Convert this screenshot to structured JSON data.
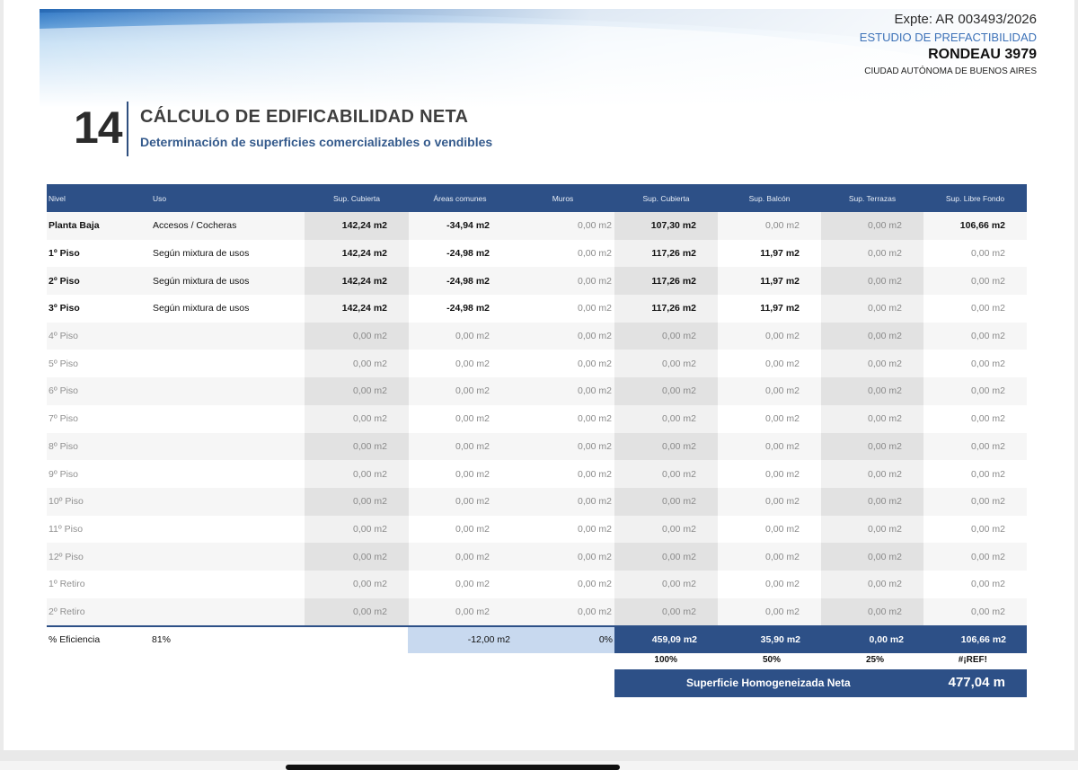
{
  "header": {
    "expediente": "Expte: AR 003493/2026",
    "estudio": "ESTUDIO DE PREFACTIBILIDAD",
    "address": "RONDEAU 3979",
    "city": "CIUDAD AUTÓNOMA DE BUENOS AIRES"
  },
  "section": {
    "number": "14",
    "title": "CÁLCULO DE EDIFICABILIDAD NETA",
    "subtitle": "Determinación de superficies comercializables o vendibles"
  },
  "table": {
    "columns": [
      "Nivel",
      "Uso",
      "Sup. Cubierta",
      "Áreas comunes",
      "Muros",
      "Sup. Cubierta",
      "Sup. Balcón",
      "Sup. Terrazas",
      "Sup. Libre Fondo"
    ],
    "rows": [
      {
        "nivel": "Planta Baja",
        "uso": "Accesos / Cocheras",
        "sup_cubierta": "142,24 m2",
        "areas_comunes": "-34,94 m2",
        "muros": "0,00 m2",
        "sup_cubierta_neta": "107,30 m2",
        "balcon": "0,00 m2",
        "terrazas": "0,00 m2",
        "libre_fondo": "106,66 m2"
      },
      {
        "nivel": "1º Piso",
        "uso": "Según mixtura de usos",
        "sup_cubierta": "142,24 m2",
        "areas_comunes": "-24,98 m2",
        "muros": "0,00 m2",
        "sup_cubierta_neta": "117,26 m2",
        "balcon": "11,97 m2",
        "terrazas": "0,00 m2",
        "libre_fondo": "0,00 m2"
      },
      {
        "nivel": "2º Piso",
        "uso": "Según mixtura de usos",
        "sup_cubierta": "142,24 m2",
        "areas_comunes": "-24,98 m2",
        "muros": "0,00 m2",
        "sup_cubierta_neta": "117,26 m2",
        "balcon": "11,97 m2",
        "terrazas": "0,00 m2",
        "libre_fondo": "0,00 m2"
      },
      {
        "nivel": "3º Piso",
        "uso": "Según mixtura de usos",
        "sup_cubierta": "142,24 m2",
        "areas_comunes": "-24,98 m2",
        "muros": "0,00 m2",
        "sup_cubierta_neta": "117,26 m2",
        "balcon": "11,97 m2",
        "terrazas": "0,00 m2",
        "libre_fondo": "0,00 m2"
      },
      {
        "nivel": "4º Piso",
        "uso": "",
        "sup_cubierta": "0,00 m2",
        "areas_comunes": "0,00 m2",
        "muros": "0,00 m2",
        "sup_cubierta_neta": "0,00 m2",
        "balcon": "0,00 m2",
        "terrazas": "0,00 m2",
        "libre_fondo": "0,00 m2"
      },
      {
        "nivel": "5º Piso",
        "uso": "",
        "sup_cubierta": "0,00 m2",
        "areas_comunes": "0,00 m2",
        "muros": "0,00 m2",
        "sup_cubierta_neta": "0,00 m2",
        "balcon": "0,00 m2",
        "terrazas": "0,00 m2",
        "libre_fondo": "0,00 m2"
      },
      {
        "nivel": "6º Piso",
        "uso": "",
        "sup_cubierta": "0,00 m2",
        "areas_comunes": "0,00 m2",
        "muros": "0,00 m2",
        "sup_cubierta_neta": "0,00 m2",
        "balcon": "0,00 m2",
        "terrazas": "0,00 m2",
        "libre_fondo": "0,00 m2"
      },
      {
        "nivel": "7º Piso",
        "uso": "",
        "sup_cubierta": "0,00 m2",
        "areas_comunes": "0,00 m2",
        "muros": "0,00 m2",
        "sup_cubierta_neta": "0,00 m2",
        "balcon": "0,00 m2",
        "terrazas": "0,00 m2",
        "libre_fondo": "0,00 m2"
      },
      {
        "nivel": "8º Piso",
        "uso": "",
        "sup_cubierta": "0,00 m2",
        "areas_comunes": "0,00 m2",
        "muros": "0,00 m2",
        "sup_cubierta_neta": "0,00 m2",
        "balcon": "0,00 m2",
        "terrazas": "0,00 m2",
        "libre_fondo": "0,00 m2"
      },
      {
        "nivel": "9º Piso",
        "uso": "",
        "sup_cubierta": "0,00 m2",
        "areas_comunes": "0,00 m2",
        "muros": "0,00 m2",
        "sup_cubierta_neta": "0,00 m2",
        "balcon": "0,00 m2",
        "terrazas": "0,00 m2",
        "libre_fondo": "0,00 m2"
      },
      {
        "nivel": "10º Piso",
        "uso": "",
        "sup_cubierta": "0,00 m2",
        "areas_comunes": "0,00 m2",
        "muros": "0,00 m2",
        "sup_cubierta_neta": "0,00 m2",
        "balcon": "0,00 m2",
        "terrazas": "0,00 m2",
        "libre_fondo": "0,00 m2"
      },
      {
        "nivel": "11º Piso",
        "uso": "",
        "sup_cubierta": "0,00 m2",
        "areas_comunes": "0,00 m2",
        "muros": "0,00 m2",
        "sup_cubierta_neta": "0,00 m2",
        "balcon": "0,00 m2",
        "terrazas": "0,00 m2",
        "libre_fondo": "0,00 m2"
      },
      {
        "nivel": "12º Piso",
        "uso": "",
        "sup_cubierta": "0,00 m2",
        "areas_comunes": "0,00 m2",
        "muros": "0,00 m2",
        "sup_cubierta_neta": "0,00 m2",
        "balcon": "0,00 m2",
        "terrazas": "0,00 m2",
        "libre_fondo": "0,00 m2"
      },
      {
        "nivel": "1º Retiro",
        "uso": "",
        "sup_cubierta": "0,00 m2",
        "areas_comunes": "0,00 m2",
        "muros": "0,00 m2",
        "sup_cubierta_neta": "0,00 m2",
        "balcon": "0,00 m2",
        "terrazas": "0,00 m2",
        "libre_fondo": "0,00 m2"
      },
      {
        "nivel": "2º Retiro",
        "uso": "",
        "sup_cubierta": "0,00 m2",
        "areas_comunes": "0,00 m2",
        "muros": "0,00 m2",
        "sup_cubierta_neta": "0,00 m2",
        "balcon": "0,00 m2",
        "terrazas": "0,00 m2",
        "libre_fondo": "0,00 m2"
      }
    ]
  },
  "totals": {
    "eficiencia_label": "% Eficiencia",
    "eficiencia_value": "81%",
    "areas_comunes": "-12,00 m2",
    "muros": "0%",
    "sup_cubierta": "459,09 m2",
    "balcon": "35,90 m2",
    "terrazas": "0,00 m2",
    "libre_fondo": "106,66 m2"
  },
  "percentages": {
    "sup_cubierta": "100%",
    "balcon": "50%",
    "terrazas": "25%",
    "libre_fondo": "#¡REF!"
  },
  "homogenizada": {
    "label": "Superficie Homogeneizada Neta",
    "value": "477,04 m"
  },
  "colors": {
    "header_blue": "#2d5087",
    "light_blue": "#c8d9ef",
    "accent_text": "#3d72b8"
  }
}
